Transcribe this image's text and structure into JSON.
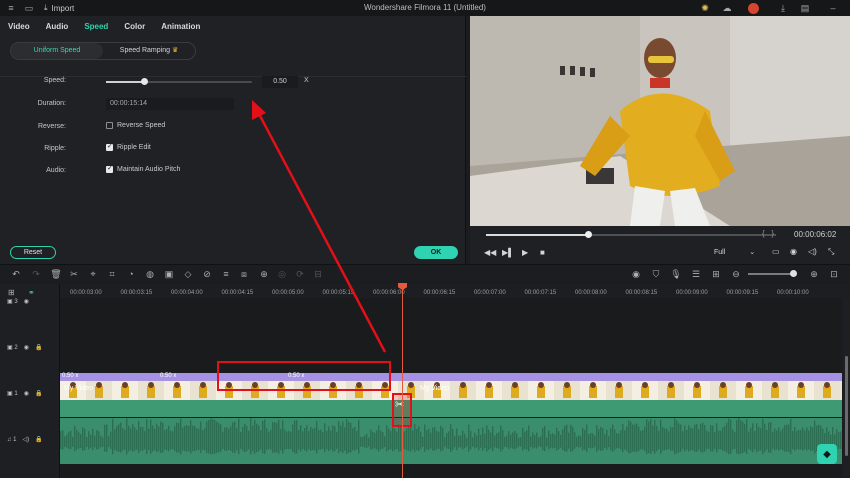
{
  "app": {
    "title": "Wondershare Filmora 11 (Untitled)",
    "import_label": "Import"
  },
  "tabs": [
    {
      "label": "Video",
      "active": false
    },
    {
      "label": "Audio",
      "active": false
    },
    {
      "label": "Speed",
      "active": true
    },
    {
      "label": "Color",
      "active": false
    },
    {
      "label": "Animation",
      "active": false
    }
  ],
  "speed_modes": {
    "uniform": "Uniform Speed",
    "ramping": "Speed Ramping",
    "selected": "Uniform Speed"
  },
  "speed_panel": {
    "speed_label": "Speed:",
    "speed_value": "0.50",
    "speed_unit": "X",
    "speed_level": 0.26,
    "duration_label": "Duration:",
    "duration_value": "00:00:15:14",
    "reverse_label": "Reverse:",
    "reverse_option": "Reverse Speed",
    "reverse_checked": false,
    "ripple_label": "Ripple:",
    "ripple_option": "Ripple Edit",
    "ripple_checked": true,
    "audio_label": "Audio:",
    "audio_option": "Maintain Audio Pitch",
    "audio_checked": true
  },
  "buttons": {
    "reset": "Reset",
    "ok": "OK"
  },
  "preview": {
    "timecode": "00:00:06:02",
    "quality": "Full",
    "progress": 0.35
  },
  "ruler_ticks": [
    "00:00:03:00",
    "00:00:03:15",
    "00:00:04:00",
    "00:00:04:15",
    "00:00:05:00",
    "00:00:05:15",
    "00:00:06:00",
    "00:00:06:15",
    "00:00:07:00",
    "00:00:07:15",
    "00:00:08:00",
    "00:00:08:15",
    "00:00:09:00",
    "00:00:09:15",
    "00:00:10:00"
  ],
  "tracks": [
    {
      "label": "3"
    },
    {
      "label": "2"
    },
    {
      "label": "1"
    },
    {
      "label": "1"
    }
  ],
  "clip": {
    "speed_badge": "0.50 x",
    "name_label": "My Video"
  },
  "colors": {
    "accent": "#2fd3b1",
    "annotation": "#e3101a",
    "playhead": "#e55a3e",
    "clip_purple": "#a592e4",
    "clip_green": "#3e9a73"
  }
}
